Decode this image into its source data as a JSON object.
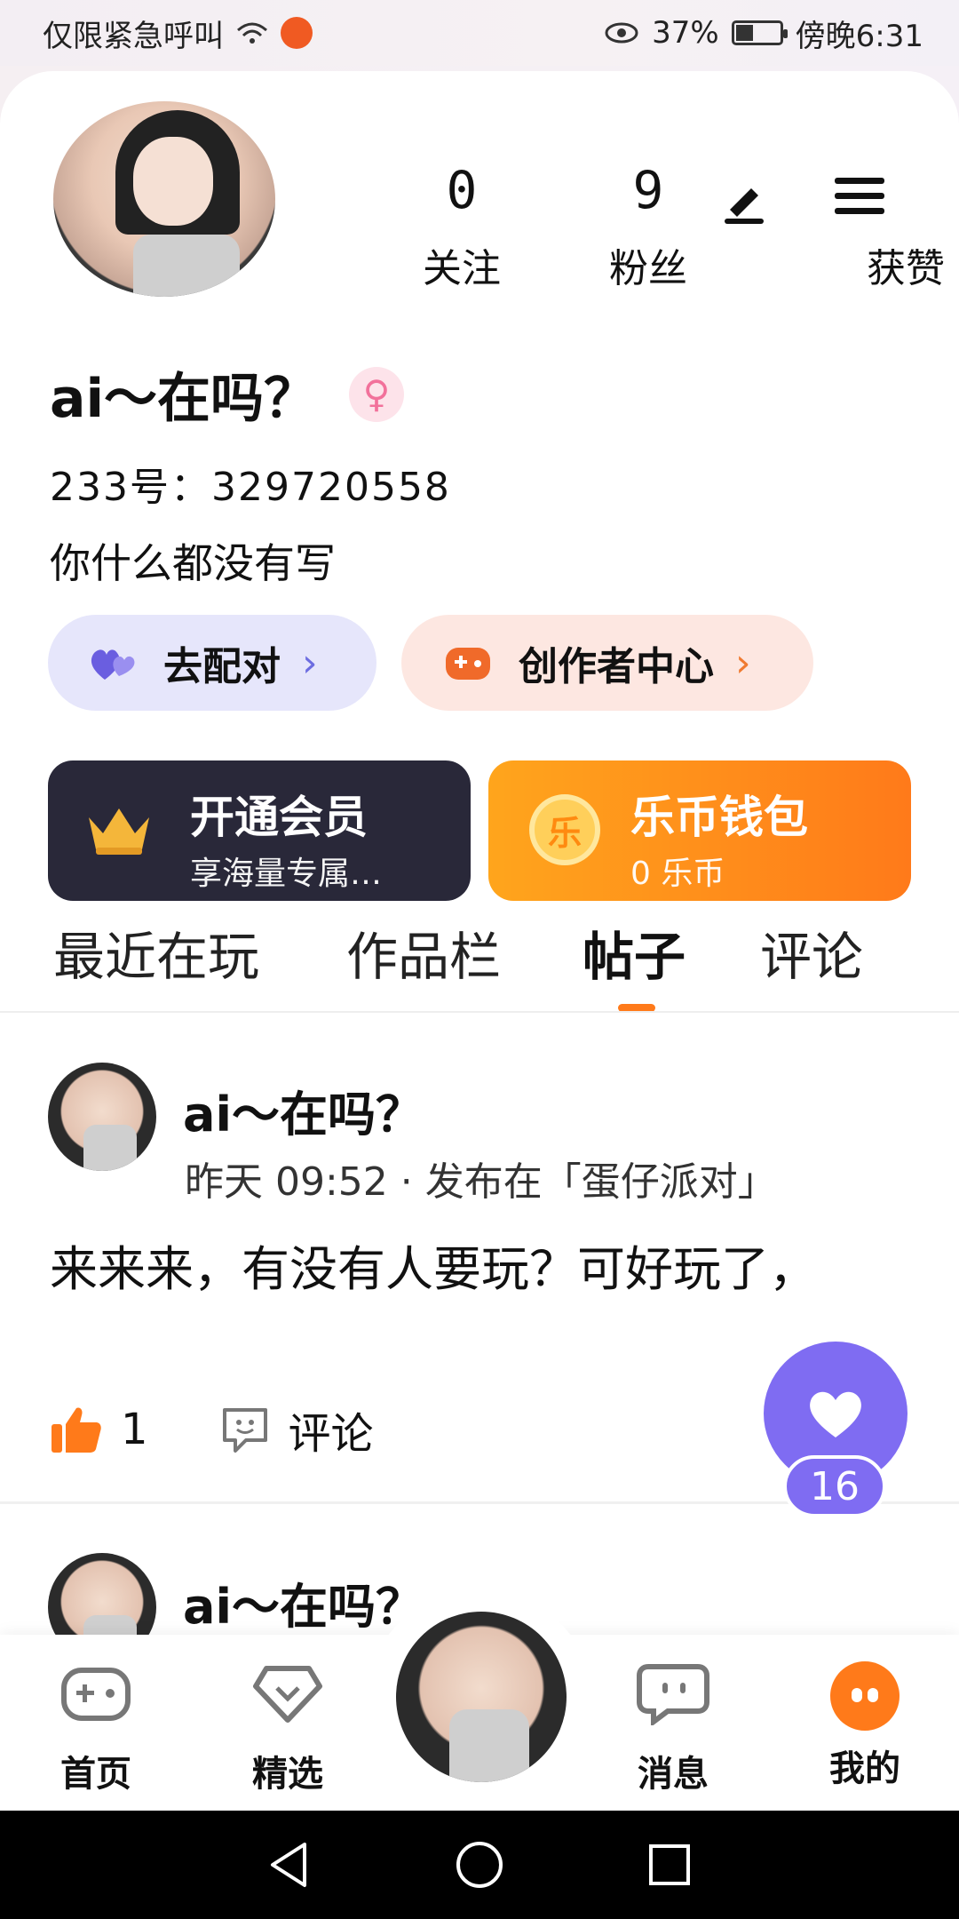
{
  "status_bar": {
    "carrier": "仅限紧急呼叫",
    "battery": "37%",
    "time": "傍晚6:31",
    "battery_level": 0.37
  },
  "profile": {
    "stats": [
      {
        "value": "0",
        "label": "关注"
      },
      {
        "value": "9",
        "label": "粉丝"
      },
      {
        "value": "",
        "label": "获赞"
      }
    ],
    "name": "ai～在吗？",
    "gender_icon": "female-icon",
    "uid": "233号：329720558",
    "bio": "你什么都没有写"
  },
  "quick_actions": {
    "match_label": "去配对",
    "creator_label": "创作者中心",
    "chevron": "›"
  },
  "banners": {
    "vip": {
      "title": "开通会员",
      "subtitle": "享海量专属…"
    },
    "wallet": {
      "title": "乐币钱包",
      "subtitle": "0 乐币",
      "coin_glyph": "乐"
    }
  },
  "tabs": [
    {
      "label": "最近在玩"
    },
    {
      "label": "作品栏"
    },
    {
      "label": "帖子",
      "active": true
    },
    {
      "label": "评论"
    }
  ],
  "posts": [
    {
      "author": "ai～在吗？",
      "meta": "昨天 09:52 · 发布在「蛋仔派对」",
      "text": "来来来，有没有人要玩？可好玩了，",
      "likes": "1",
      "comment_label": "评论"
    },
    {
      "author": "ai～在吗？"
    }
  ],
  "fab": {
    "count": "16"
  },
  "bottom_nav": [
    {
      "label": "首页"
    },
    {
      "label": "精选"
    },
    {
      "label": ""
    },
    {
      "label": "消息"
    },
    {
      "label": "我的"
    }
  ],
  "colors": {
    "accent_orange": "#ff7a1a",
    "accent_purple": "#7f6cf2",
    "vip_dark": "#292839"
  }
}
